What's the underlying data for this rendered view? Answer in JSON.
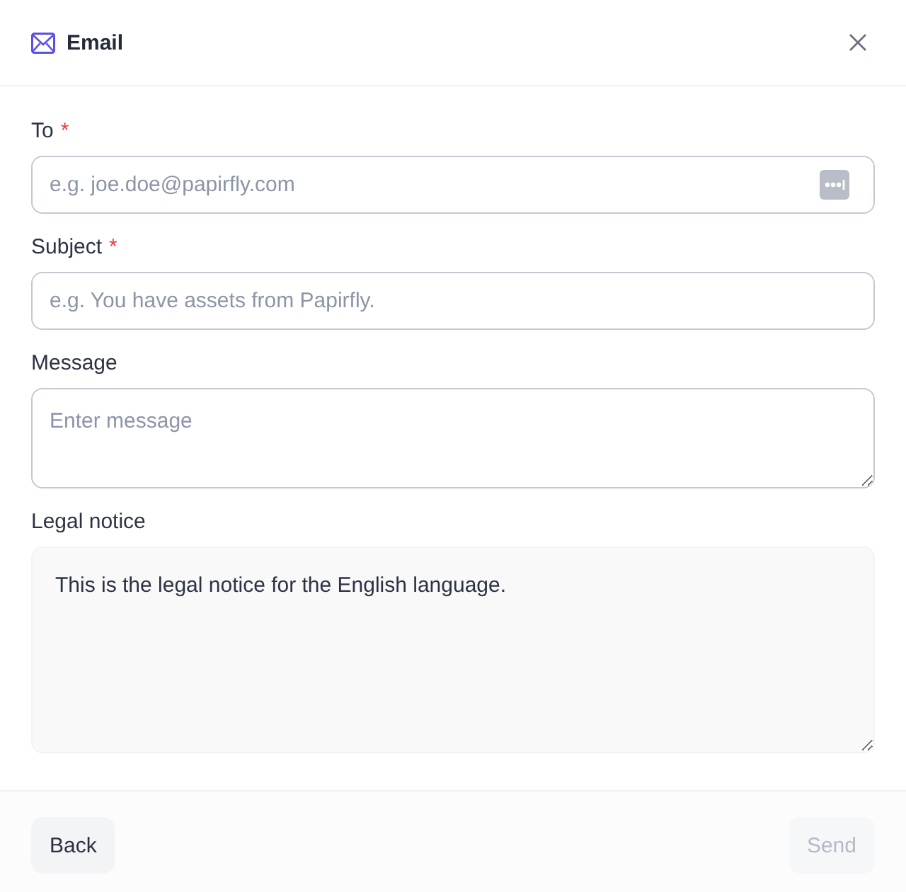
{
  "dialog": {
    "title": "Email"
  },
  "fields": [
    {
      "kind": "input",
      "label": "To",
      "required_mark": "*",
      "placeholder": "e.g. joe.doe@papirfly.com",
      "trailing_button": true
    },
    {
      "kind": "input",
      "label": "Subject",
      "required_mark": "*",
      "placeholder": "e.g. You have assets from Papirfly.",
      "trailing_button": false
    },
    {
      "kind": "textarea",
      "label": "Message",
      "placeholder": "Enter message",
      "read_only": false
    },
    {
      "kind": "textarea",
      "label": "Legal notice",
      "value": "This is the legal notice for the English language.",
      "read_only": true
    }
  ],
  "footer": {
    "buttons": [
      {
        "label": "Back",
        "disabled": false
      },
      {
        "label": "Send",
        "disabled": true
      }
    ]
  }
}
